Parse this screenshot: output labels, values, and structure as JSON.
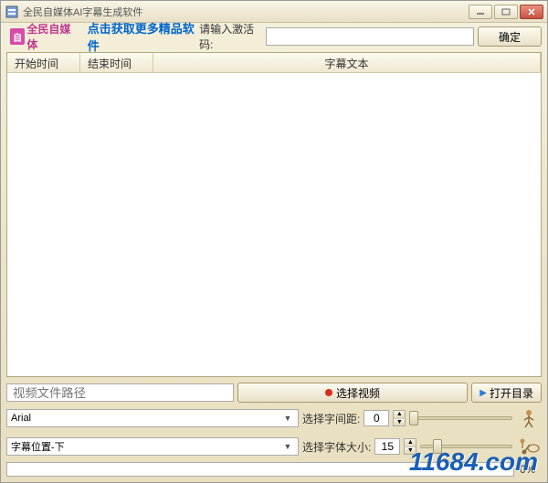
{
  "window": {
    "title": "全民自媒体AI字幕生成软件"
  },
  "toolbar": {
    "logo_text": "全民自媒体",
    "promo_link": "点击获取更多精品软件",
    "activation_label": "请输入激活码:",
    "activation_value": "",
    "confirm_label": "确定"
  },
  "list": {
    "col1": "开始时间",
    "col2": "结束时间",
    "col3": "字幕文本"
  },
  "paths": {
    "video_placeholder": "视频文件路径",
    "select_video_label": "选择视频",
    "open_dir_label": "打开目录",
    "open_dir_icon": "▶"
  },
  "font": {
    "dropdown_value": "Arial",
    "spacing_label": "选择字间距:",
    "spacing_value": "0"
  },
  "position": {
    "dropdown_value": "字幕位置-下",
    "size_label": "选择字体大小:",
    "size_value": "15"
  },
  "progress": {
    "percent_label": "0%"
  },
  "watermark": "11684.com"
}
